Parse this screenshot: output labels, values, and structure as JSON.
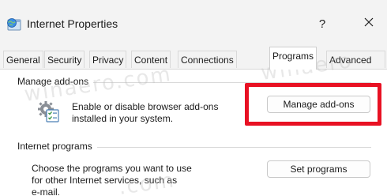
{
  "window": {
    "title": "Internet Properties",
    "help_label": "?",
    "close_icon": "close-icon",
    "app_icon": "internet-globe-icon"
  },
  "tabs": [
    {
      "label": "General",
      "active": false
    },
    {
      "label": "Security",
      "active": false
    },
    {
      "label": "Privacy",
      "active": false
    },
    {
      "label": "Content",
      "active": false
    },
    {
      "label": "Connections",
      "active": false
    },
    {
      "label": "Programs",
      "active": true
    },
    {
      "label": "Advanced",
      "active": false
    }
  ],
  "manage_addons": {
    "group_label": "Manage add-ons",
    "icon": "addons-checklist-icon",
    "description_line1": "Enable or disable browser add-ons",
    "description_line2": "installed in your system.",
    "button_label": "Manage add-ons"
  },
  "internet_programs": {
    "group_label": "Internet programs",
    "description_line1": "Choose the programs you want to use",
    "description_line2": "for other Internet services, such as",
    "description_line3": "e-mail.",
    "button_label": "Set programs"
  },
  "colors": {
    "highlight": "#e81123",
    "background": "#f3f3f3",
    "panel": "#ffffff"
  }
}
